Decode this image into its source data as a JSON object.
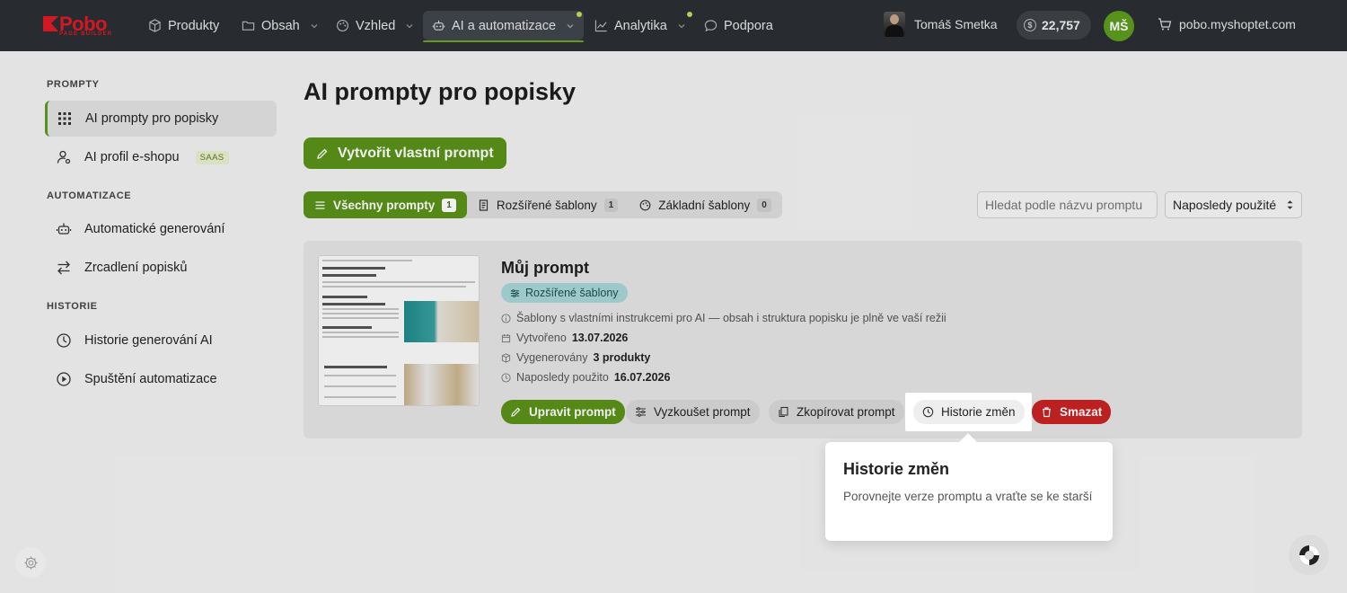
{
  "logo": {
    "brand": "Pobo",
    "sub": "PAGE BUILDER"
  },
  "nav": {
    "products": "Produkty",
    "content": "Obsah",
    "appearance": "Vzhled",
    "ai": "AI a automatizace",
    "analytics": "Analytika",
    "support": "Podpora"
  },
  "user": {
    "name": "Tomáš Smetka",
    "initials": "MŠ",
    "credits": "22,757",
    "shop": "pobo.myshoptet.com"
  },
  "sidebar": {
    "section_prompts": "PROMPTY",
    "item_ai_prompts": "AI prompty pro popisky",
    "item_ai_profile": "AI profil e-shopu",
    "saas_badge": "SAAS",
    "section_automation": "AUTOMATIZACE",
    "item_auto_gen": "Automatické generování",
    "item_mirror": "Zrcadlení popisků",
    "section_history": "HISTORIE",
    "item_gen_history": "Historie generování AI",
    "item_auto_runs": "Spuštění automatizace"
  },
  "main": {
    "title": "AI prompty pro popisky",
    "create_button": "Vytvořit vlastní prompt",
    "tabs": [
      {
        "label": "Všechny prompty",
        "count": "1"
      },
      {
        "label": "Rozšířené šablony",
        "count": "1"
      },
      {
        "label": "Základní šablony",
        "count": "0"
      }
    ],
    "search_placeholder": "Hledat podle názvu promptu",
    "sort_value": "Naposledy použité"
  },
  "card": {
    "title": "Můj prompt",
    "badge": "Rozšířené šablony",
    "description": "Šablony s vlastními instrukcemi pro AI — obsah i struktura popisku je plně ve vaší režii",
    "created_label": "Vytvořeno",
    "created_value": "13.07.2026",
    "generated_label": "Vygenerovány",
    "generated_value": "3 produkty",
    "last_used_label": "Naposledy použito",
    "last_used_value": "16.07.2026",
    "actions": {
      "edit": "Upravit prompt",
      "test": "Vyzkoušet prompt",
      "copy": "Zkopírovat prompt",
      "history": "Historie změn",
      "delete": "Smazat"
    }
  },
  "tooltip": {
    "title": "Historie změn",
    "body": "Porovnejte verze promptu a vraťte se ke starší"
  },
  "colors": {
    "accent": "#5a9219",
    "danger": "#c92222",
    "topbar": "#2b2e33",
    "badge": "#a8d6d8"
  }
}
